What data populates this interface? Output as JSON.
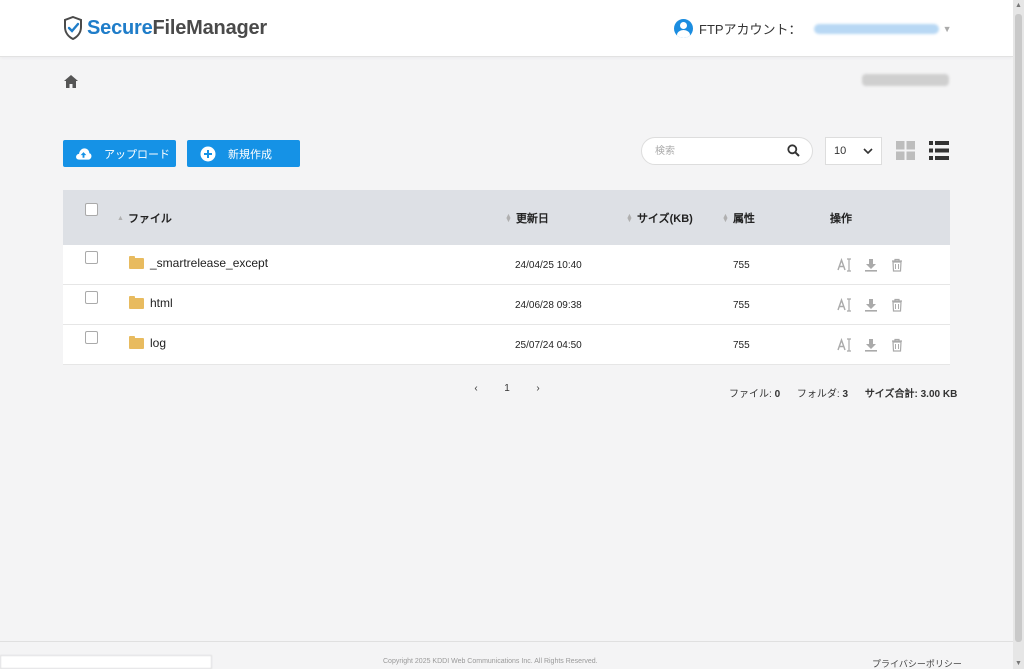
{
  "header": {
    "logo_secure": "Secure",
    "logo_rest": "FileManager",
    "account_label": "FTPアカウント：",
    "account_value": "",
    "email": ""
  },
  "toolbar": {
    "upload_label": "アップロード",
    "new_label": "新規作成",
    "search_placeholder": "検索",
    "per_page": "10"
  },
  "table": {
    "columns": {
      "file": "ファイル",
      "updated": "更新日",
      "size": "サイズ(KB)",
      "attr": "属性",
      "ops": "操作"
    },
    "rows": [
      {
        "name": "_smartrelease_except",
        "updated": "24/04/25 10:40",
        "size": "",
        "attr": "755"
      },
      {
        "name": "html",
        "updated": "24/06/28 09:38",
        "size": "",
        "attr": "755"
      },
      {
        "name": "log",
        "updated": "25/07/24 04:50",
        "size": "",
        "attr": "755"
      }
    ]
  },
  "pagination": {
    "prev": "‹",
    "current": "1",
    "next": "›"
  },
  "summary": {
    "files_label": "ファイル:",
    "files_count": "0",
    "folders_label": "フォルダ:",
    "folders_count": "3",
    "total_label": "サイズ合計:",
    "total_value": "3.00 KB"
  },
  "footer": {
    "copyright": "Copyright 2025 KDDI Web Communications Inc. All Rights Reserved.",
    "privacy": "プライバシーポリシー"
  },
  "colors": {
    "accent": "#1592e6",
    "brand_blue": "#1f7dc9",
    "table_header": "#dde0e5",
    "folder": "#e8bb5f"
  }
}
